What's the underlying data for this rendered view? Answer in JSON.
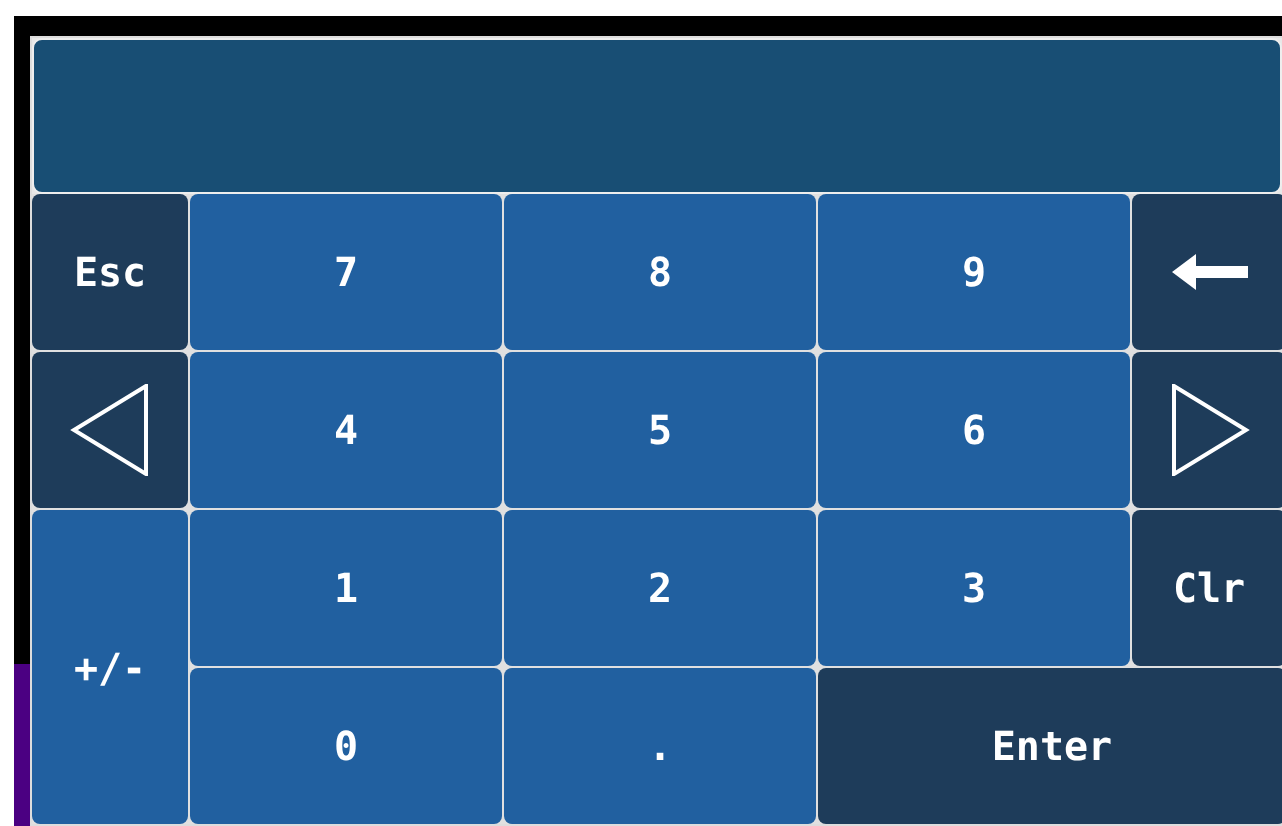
{
  "keys": [
    {
      "kind": "command",
      "label": "Esc"
    },
    {
      "kind": "digit",
      "label": "7"
    },
    {
      "kind": "digit",
      "label": "8"
    },
    {
      "kind": "digit",
      "label": "9"
    },
    {
      "kind": "backarrow"
    },
    {
      "kind": "lefttriangle"
    },
    {
      "kind": "digit",
      "label": "4"
    },
    {
      "kind": "digit",
      "label": "5"
    },
    {
      "kind": "digit",
      "label": "6"
    },
    {
      "kind": "righttriangle"
    },
    {
      "kind": "sign",
      "label": "+/-"
    },
    {
      "kind": "digit",
      "label": "1"
    },
    {
      "kind": "digit",
      "label": "2"
    },
    {
      "kind": "digit",
      "label": "3"
    },
    {
      "kind": "command",
      "label": "Clr"
    },
    {
      "kind": "digit",
      "label": "0"
    },
    {
      "kind": "digit",
      "label": "."
    },
    {
      "kind": "enter",
      "label": "Enter"
    }
  ]
}
